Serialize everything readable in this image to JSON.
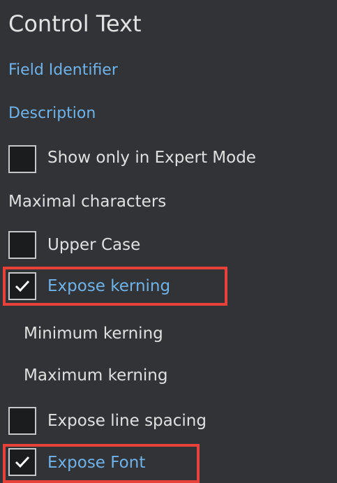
{
  "section": {
    "title": "Control Text",
    "field_identifier": "Field Identifier",
    "description": "Description"
  },
  "options": {
    "show_expert": {
      "label": "Show only in Expert Mode",
      "checked": false
    },
    "maximal_characters": "Maximal characters",
    "upper_case": {
      "label": "Upper Case",
      "checked": false
    },
    "expose_kerning": {
      "label": "Expose kerning",
      "checked": true
    },
    "minimum_kerning": "Minimum kerning",
    "maximum_kerning": "Maximum kerning",
    "expose_line_spacing": {
      "label": "Expose line spacing",
      "checked": false
    },
    "expose_font": {
      "label": "Expose Font",
      "checked": true
    }
  },
  "colors": {
    "background": "#313336",
    "link": "#6fb3ea",
    "highlight": "#e8413a"
  },
  "icons": {
    "checkmark": "checkmark-icon"
  }
}
